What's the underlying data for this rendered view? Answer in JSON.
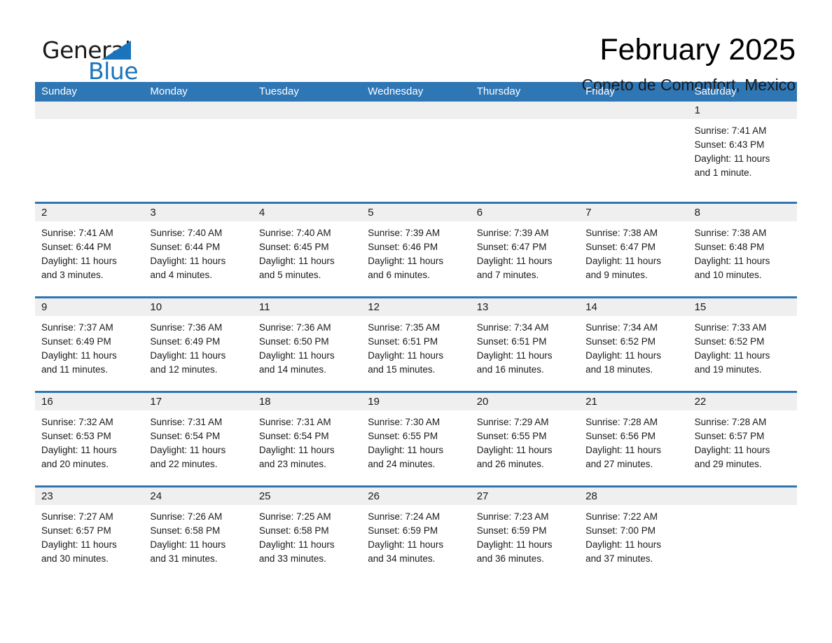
{
  "brand": {
    "name_part1": "General",
    "name_part2": "Blue",
    "flag_icon": "triangle-flag-icon"
  },
  "header": {
    "title": "February 2025",
    "subtitle": "Coneto de Comonfort, Mexico"
  },
  "colors": {
    "header_blue": "#2f76b5",
    "brand_blue": "#1b74bb",
    "day_strip_gray": "#efefef",
    "text": "#1a1a1a"
  },
  "weekdays": [
    "Sunday",
    "Monday",
    "Tuesday",
    "Wednesday",
    "Thursday",
    "Friday",
    "Saturday"
  ],
  "labels": {
    "sunrise_prefix": "Sunrise:",
    "sunset_prefix": "Sunset:",
    "daylight_prefix": "Daylight:"
  },
  "weeks": [
    [
      {
        "day": "",
        "empty": true
      },
      {
        "day": "",
        "empty": true
      },
      {
        "day": "",
        "empty": true
      },
      {
        "day": "",
        "empty": true
      },
      {
        "day": "",
        "empty": true
      },
      {
        "day": "",
        "empty": true
      },
      {
        "day": "1",
        "sunrise": "Sunrise: 7:41 AM",
        "sunset": "Sunset: 6:43 PM",
        "daylight_line1": "Daylight: 11 hours",
        "daylight_line2": "and 1 minute."
      }
    ],
    [
      {
        "day": "2",
        "sunrise": "Sunrise: 7:41 AM",
        "sunset": "Sunset: 6:44 PM",
        "daylight_line1": "Daylight: 11 hours",
        "daylight_line2": "and 3 minutes."
      },
      {
        "day": "3",
        "sunrise": "Sunrise: 7:40 AM",
        "sunset": "Sunset: 6:44 PM",
        "daylight_line1": "Daylight: 11 hours",
        "daylight_line2": "and 4 minutes."
      },
      {
        "day": "4",
        "sunrise": "Sunrise: 7:40 AM",
        "sunset": "Sunset: 6:45 PM",
        "daylight_line1": "Daylight: 11 hours",
        "daylight_line2": "and 5 minutes."
      },
      {
        "day": "5",
        "sunrise": "Sunrise: 7:39 AM",
        "sunset": "Sunset: 6:46 PM",
        "daylight_line1": "Daylight: 11 hours",
        "daylight_line2": "and 6 minutes."
      },
      {
        "day": "6",
        "sunrise": "Sunrise: 7:39 AM",
        "sunset": "Sunset: 6:47 PM",
        "daylight_line1": "Daylight: 11 hours",
        "daylight_line2": "and 7 minutes."
      },
      {
        "day": "7",
        "sunrise": "Sunrise: 7:38 AM",
        "sunset": "Sunset: 6:47 PM",
        "daylight_line1": "Daylight: 11 hours",
        "daylight_line2": "and 9 minutes."
      },
      {
        "day": "8",
        "sunrise": "Sunrise: 7:38 AM",
        "sunset": "Sunset: 6:48 PM",
        "daylight_line1": "Daylight: 11 hours",
        "daylight_line2": "and 10 minutes."
      }
    ],
    [
      {
        "day": "9",
        "sunrise": "Sunrise: 7:37 AM",
        "sunset": "Sunset: 6:49 PM",
        "daylight_line1": "Daylight: 11 hours",
        "daylight_line2": "and 11 minutes."
      },
      {
        "day": "10",
        "sunrise": "Sunrise: 7:36 AM",
        "sunset": "Sunset: 6:49 PM",
        "daylight_line1": "Daylight: 11 hours",
        "daylight_line2": "and 12 minutes."
      },
      {
        "day": "11",
        "sunrise": "Sunrise: 7:36 AM",
        "sunset": "Sunset: 6:50 PM",
        "daylight_line1": "Daylight: 11 hours",
        "daylight_line2": "and 14 minutes."
      },
      {
        "day": "12",
        "sunrise": "Sunrise: 7:35 AM",
        "sunset": "Sunset: 6:51 PM",
        "daylight_line1": "Daylight: 11 hours",
        "daylight_line2": "and 15 minutes."
      },
      {
        "day": "13",
        "sunrise": "Sunrise: 7:34 AM",
        "sunset": "Sunset: 6:51 PM",
        "daylight_line1": "Daylight: 11 hours",
        "daylight_line2": "and 16 minutes."
      },
      {
        "day": "14",
        "sunrise": "Sunrise: 7:34 AM",
        "sunset": "Sunset: 6:52 PM",
        "daylight_line1": "Daylight: 11 hours",
        "daylight_line2": "and 18 minutes."
      },
      {
        "day": "15",
        "sunrise": "Sunrise: 7:33 AM",
        "sunset": "Sunset: 6:52 PM",
        "daylight_line1": "Daylight: 11 hours",
        "daylight_line2": "and 19 minutes."
      }
    ],
    [
      {
        "day": "16",
        "sunrise": "Sunrise: 7:32 AM",
        "sunset": "Sunset: 6:53 PM",
        "daylight_line1": "Daylight: 11 hours",
        "daylight_line2": "and 20 minutes."
      },
      {
        "day": "17",
        "sunrise": "Sunrise: 7:31 AM",
        "sunset": "Sunset: 6:54 PM",
        "daylight_line1": "Daylight: 11 hours",
        "daylight_line2": "and 22 minutes."
      },
      {
        "day": "18",
        "sunrise": "Sunrise: 7:31 AM",
        "sunset": "Sunset: 6:54 PM",
        "daylight_line1": "Daylight: 11 hours",
        "daylight_line2": "and 23 minutes."
      },
      {
        "day": "19",
        "sunrise": "Sunrise: 7:30 AM",
        "sunset": "Sunset: 6:55 PM",
        "daylight_line1": "Daylight: 11 hours",
        "daylight_line2": "and 24 minutes."
      },
      {
        "day": "20",
        "sunrise": "Sunrise: 7:29 AM",
        "sunset": "Sunset: 6:55 PM",
        "daylight_line1": "Daylight: 11 hours",
        "daylight_line2": "and 26 minutes."
      },
      {
        "day": "21",
        "sunrise": "Sunrise: 7:28 AM",
        "sunset": "Sunset: 6:56 PM",
        "daylight_line1": "Daylight: 11 hours",
        "daylight_line2": "and 27 minutes."
      },
      {
        "day": "22",
        "sunrise": "Sunrise: 7:28 AM",
        "sunset": "Sunset: 6:57 PM",
        "daylight_line1": "Daylight: 11 hours",
        "daylight_line2": "and 29 minutes."
      }
    ],
    [
      {
        "day": "23",
        "sunrise": "Sunrise: 7:27 AM",
        "sunset": "Sunset: 6:57 PM",
        "daylight_line1": "Daylight: 11 hours",
        "daylight_line2": "and 30 minutes."
      },
      {
        "day": "24",
        "sunrise": "Sunrise: 7:26 AM",
        "sunset": "Sunset: 6:58 PM",
        "daylight_line1": "Daylight: 11 hours",
        "daylight_line2": "and 31 minutes."
      },
      {
        "day": "25",
        "sunrise": "Sunrise: 7:25 AM",
        "sunset": "Sunset: 6:58 PM",
        "daylight_line1": "Daylight: 11 hours",
        "daylight_line2": "and 33 minutes."
      },
      {
        "day": "26",
        "sunrise": "Sunrise: 7:24 AM",
        "sunset": "Sunset: 6:59 PM",
        "daylight_line1": "Daylight: 11 hours",
        "daylight_line2": "and 34 minutes."
      },
      {
        "day": "27",
        "sunrise": "Sunrise: 7:23 AM",
        "sunset": "Sunset: 6:59 PM",
        "daylight_line1": "Daylight: 11 hours",
        "daylight_line2": "and 36 minutes."
      },
      {
        "day": "28",
        "sunrise": "Sunrise: 7:22 AM",
        "sunset": "Sunset: 7:00 PM",
        "daylight_line1": "Daylight: 11 hours",
        "daylight_line2": "and 37 minutes."
      },
      {
        "day": "",
        "empty": true
      }
    ]
  ]
}
